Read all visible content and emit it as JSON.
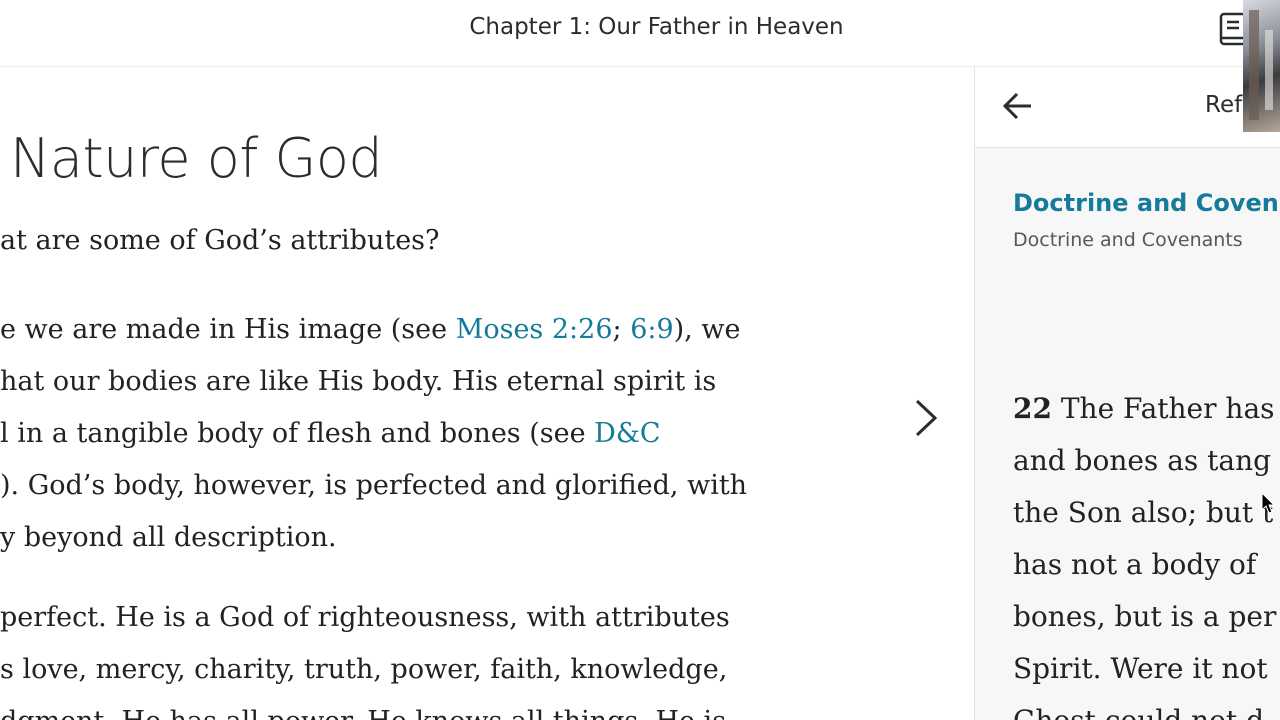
{
  "header": {
    "chapter_title": "Chapter 1: Our Father in Heaven"
  },
  "content": {
    "section_heading": "Nature of God",
    "question": "at are some of God’s attributes?",
    "paragraph1": {
      "line1": {
        "before": "e we are made in His image (see ",
        "link1": "Moses 2:26",
        "sep": "; ",
        "link2": "6:9",
        "after": "), we"
      },
      "line2": "hat our bodies are like His body. His eternal spirit is",
      "line3": {
        "before": "l in a tangible body of flesh and bones (see ",
        "link": "D&C"
      },
      "line4": "). God’s body, however, is perfected and glorified, with",
      "line5": "y beyond all description."
    },
    "paragraph2": {
      "line1": " perfect. He is a God of righteousness, with attributes",
      "line2": "s love, mercy, charity, truth, power, faith, knowledge,",
      "line3": "dgment. He has all power. He knows all things. He is"
    }
  },
  "side_panel": {
    "title": "Ref",
    "reference_title": "Doctrine and Covenan",
    "reference_subtitle": "Doctrine and Covenants",
    "verse": {
      "number": "22",
      "line1": " The Father has",
      "line2": "and bones as tang",
      "line3": "the Son also; but t",
      "line4": "has not a body of",
      "line5": "bones, but is a per",
      "line6": "Spirit. Were it not",
      "line7": "Ghost could not d"
    }
  },
  "icons": {
    "book": "book-icon",
    "next": "chevron-right-icon",
    "back": "arrow-left-icon",
    "cursor": "mouse-cursor-icon"
  },
  "colors": {
    "link": "#157b9a",
    "text": "#212225",
    "panel_bg": "#f7f7f7"
  }
}
